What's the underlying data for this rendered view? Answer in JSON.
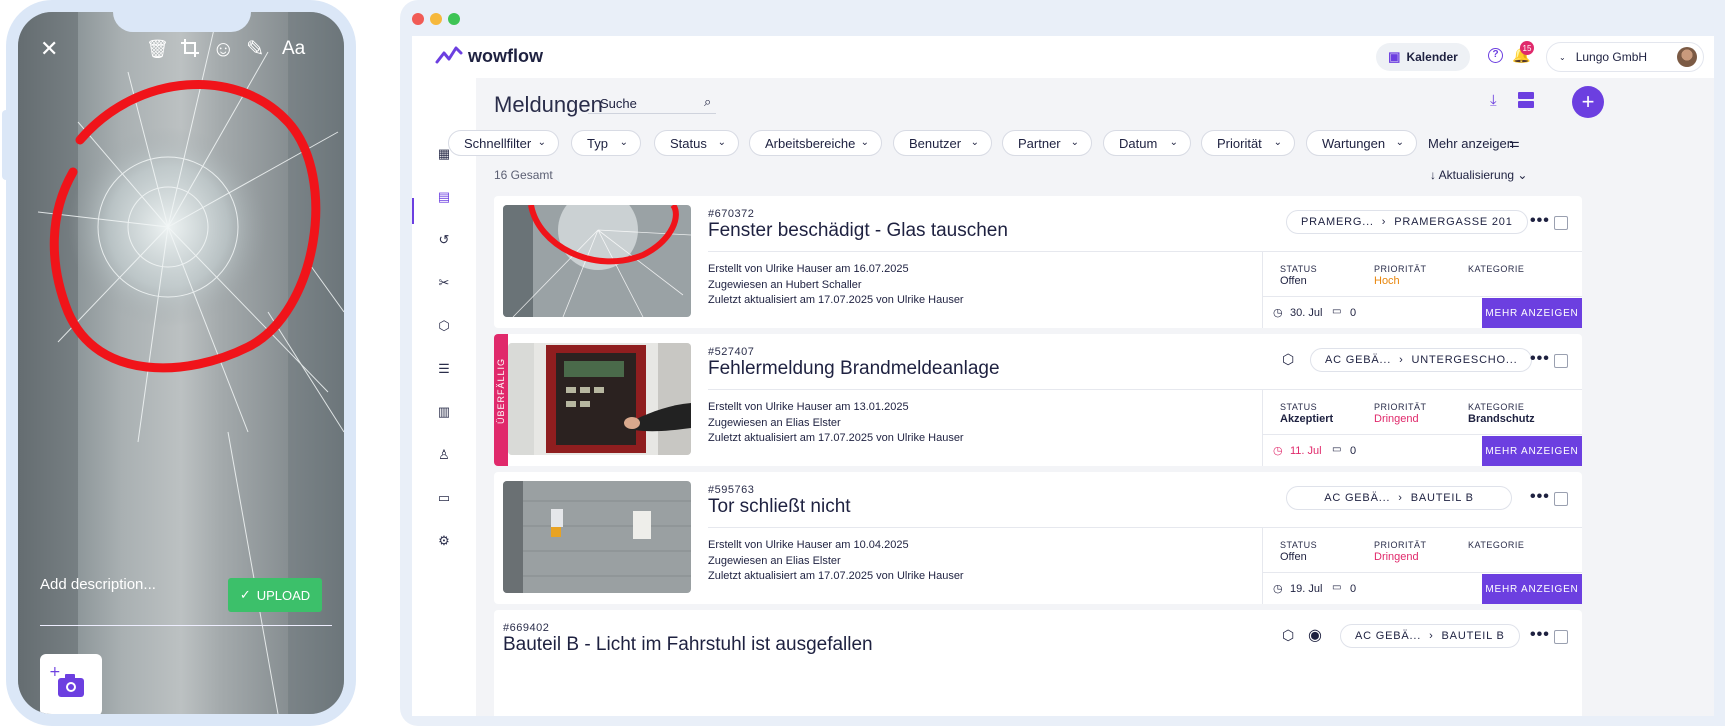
{
  "phone": {
    "description_placeholder": "Add description...",
    "upload_label": "UPLOAD",
    "text_tool": "Aa"
  },
  "app": {
    "brand": "wowflow",
    "calendar_label": "Kalender",
    "notification_count": "15",
    "company": "Lungo GmbH",
    "page_title": "Meldungen",
    "search_placeholder": "Suche",
    "filters": [
      "Schnellfilter",
      "Typ",
      "Status",
      "Arbeitsbereiche",
      "Benutzer",
      "Partner",
      "Datum",
      "Priorität",
      "Wartungen"
    ],
    "more_filters": "Mehr anzeigen",
    "total": "16 Gesamt",
    "sort": "Aktualisierung",
    "labels": {
      "status": "STATUS",
      "priority": "PRIORITÄT",
      "category": "KATEGORIE",
      "more": "MEHR ANZEIGEN",
      "overdue": "ÜBERFÄLLIG"
    }
  },
  "cards": [
    {
      "id": "#670372",
      "title": "Fenster beschädigt - Glas tauschen",
      "loc1": "PRAMERG...",
      "loc2": "PRAMERGASSE 201",
      "created_prefix": "Erstellt von ",
      "created_by": "Ulrike Hauser",
      "created_mid": " am ",
      "created_date": "16.07.2025",
      "assigned_prefix": "Zugewiesen an ",
      "assigned_to": "Hubert Schaller",
      "updated_prefix": "Zuletzt aktualisiert am ",
      "updated_date": "17.07.2025",
      "updated_mid": " von ",
      "updated_by": "Ulrike Hauser",
      "status": "Offen",
      "priority": "Hoch",
      "category": "",
      "due": "30. Jul",
      "comments": "0"
    },
    {
      "id": "#527407",
      "title": "Fehlermeldung Brandmeldeanlage",
      "loc1": "AC GEBÄ...",
      "loc2": "UNTERGESCHO...",
      "created_prefix": "Erstellt von ",
      "created_by": "Ulrike Hauser",
      "created_mid": " am ",
      "created_date": "13.01.2025",
      "assigned_prefix": "Zugewiesen an ",
      "assigned_to": "Elias Elster",
      "updated_prefix": "Zuletzt aktualisiert am ",
      "updated_date": "17.07.2025",
      "updated_mid": " von ",
      "updated_by": "Ulrike Hauser",
      "status": "Akzeptiert",
      "priority": "Dringend",
      "category": "Brandschutz",
      "due": "11. Jul",
      "comments": "0"
    },
    {
      "id": "#595763",
      "title": "Tor schließt nicht",
      "loc1": "AC GEBÄ...",
      "loc2": "BAUTEIL B",
      "created_prefix": "Erstellt von ",
      "created_by": "Ulrike Hauser",
      "created_mid": " am ",
      "created_date": "10.04.2025",
      "assigned_prefix": "Zugewiesen an ",
      "assigned_to": "Elias Elster",
      "updated_prefix": "Zuletzt aktualisiert am ",
      "updated_date": "17.07.2025",
      "updated_mid": " von ",
      "updated_by": "Ulrike Hauser",
      "status": "Offen",
      "priority": "Dringend",
      "category": "",
      "due": "19. Jul",
      "comments": "0"
    },
    {
      "id": "#669402",
      "title": "Bauteil B - Licht im Fahrstuhl ist ausgefallen",
      "loc1": "AC GEBÄ...",
      "loc2": "BAUTEIL B"
    }
  ],
  "colors": {
    "accent": "#6c3fe0",
    "urgent": "#e0296b",
    "high": "#e8860c",
    "success": "#3cc06a"
  }
}
